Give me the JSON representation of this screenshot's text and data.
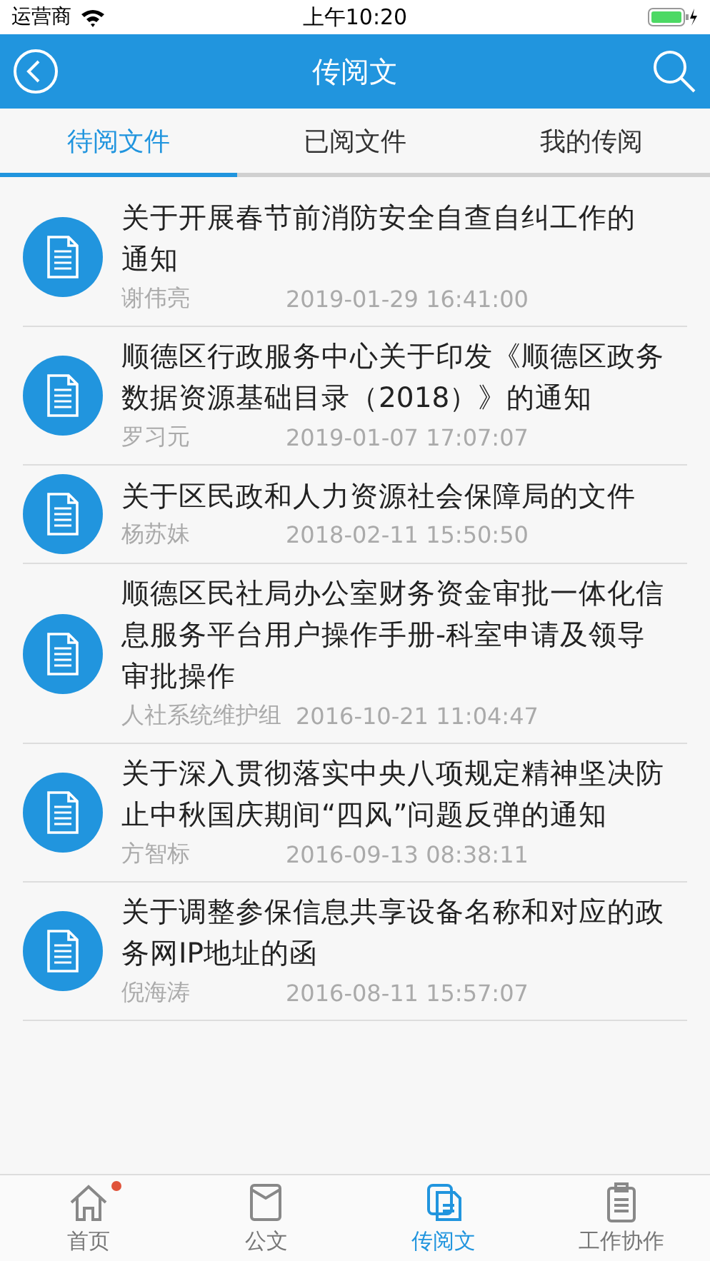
{
  "status_bar": {
    "carrier": "运营商",
    "time": "上午10:20"
  },
  "header": {
    "title": "传阅文"
  },
  "tabs": [
    {
      "label": "待阅文件",
      "selected": true
    },
    {
      "label": "已阅文件",
      "selected": false
    },
    {
      "label": "我的传阅",
      "selected": false
    }
  ],
  "documents": [
    {
      "title_lines": [
        "关于开展春节前消防安全自查自纠工作的",
        "通知"
      ],
      "author": "谢伟亮",
      "time": "2019-01-29 16:41:00"
    },
    {
      "title_lines": [
        "顺德区行政服务中心关于印发《顺德区政务",
        "数据资源基础目录（2018）》的通知"
      ],
      "author": "罗习元",
      "time": "2019-01-07 17:07:07"
    },
    {
      "title_lines": [
        "关于区民政和人力资源社会保障局的文件"
      ],
      "author": "杨苏妹",
      "time": "2018-02-11 15:50:50"
    },
    {
      "title_lines": [
        "顺德区民社局办公室财务资金审批一体化信",
        "息服务平台用户操作手册-科室申请及领导",
        "审批操作"
      ],
      "author": "人社系统维护组",
      "time": "2016-10-21 11:04:47"
    },
    {
      "title_lines": [
        "关于深入贯彻落实中央八项规定精神坚决防",
        "止中秋国庆期间“四风”问题反弹的通知"
      ],
      "author": "方智标",
      "time": "2016-09-13 08:38:11"
    },
    {
      "title_lines": [
        "关于调整参保信息共享设备名称和对应的政",
        "务网IP地址的函"
      ],
      "author": "倪海涛",
      "time": "2016-08-11 15:57:07"
    }
  ],
  "bottom_nav": [
    {
      "kind": "home",
      "label": "首页",
      "selected": false,
      "badge": true
    },
    {
      "kind": "doc",
      "label": "公文",
      "selected": false,
      "badge": false
    },
    {
      "kind": "circulate",
      "label": "传阅文",
      "selected": true,
      "badge": false
    },
    {
      "kind": "clipboard",
      "label": "工作协作",
      "selected": false,
      "badge": false
    }
  ]
}
